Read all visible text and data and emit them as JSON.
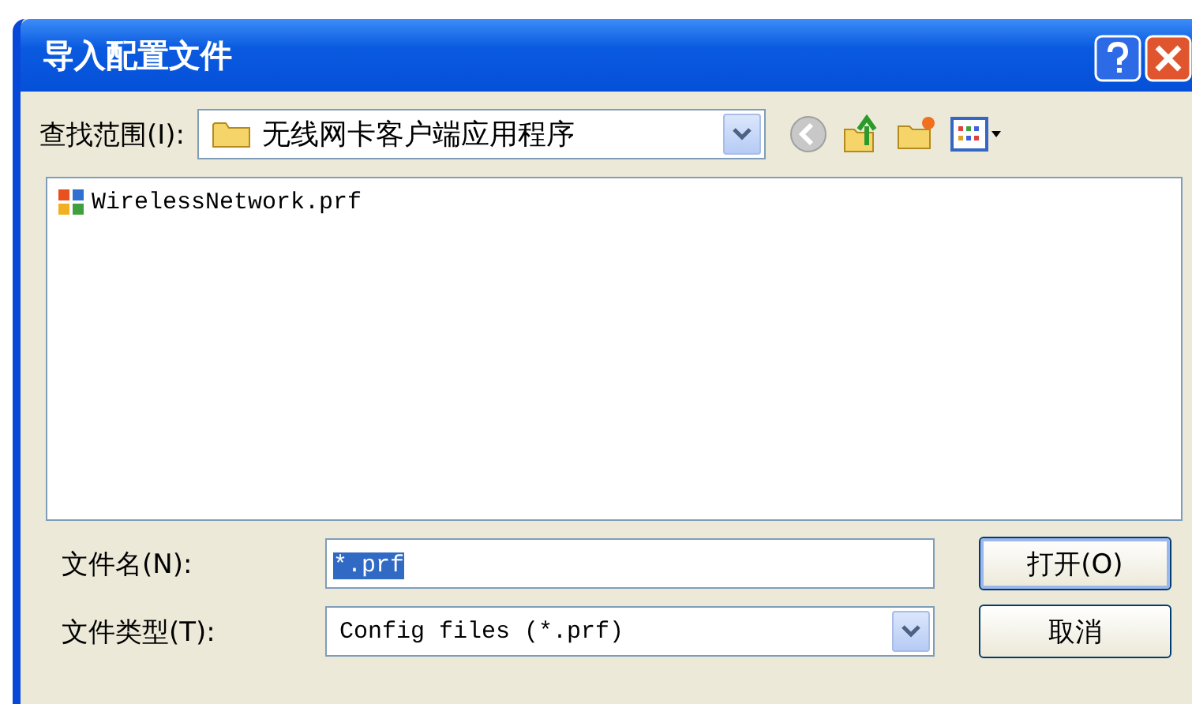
{
  "window": {
    "title": "导入配置文件"
  },
  "look_in": {
    "label": "查找范围(I):",
    "value": "无线网卡客户端应用程序"
  },
  "files": [
    {
      "name": "WirelessNetwork.prf",
      "selected": false
    }
  ],
  "file_name": {
    "label": "文件名(N):",
    "value": "*.prf",
    "text_selected": true
  },
  "file_type": {
    "label": "文件类型(T):",
    "value": "Config files (*.prf)"
  },
  "buttons": [
    {
      "label": "打开(O)",
      "default": true
    },
    {
      "label": "取消",
      "default": false
    }
  ]
}
